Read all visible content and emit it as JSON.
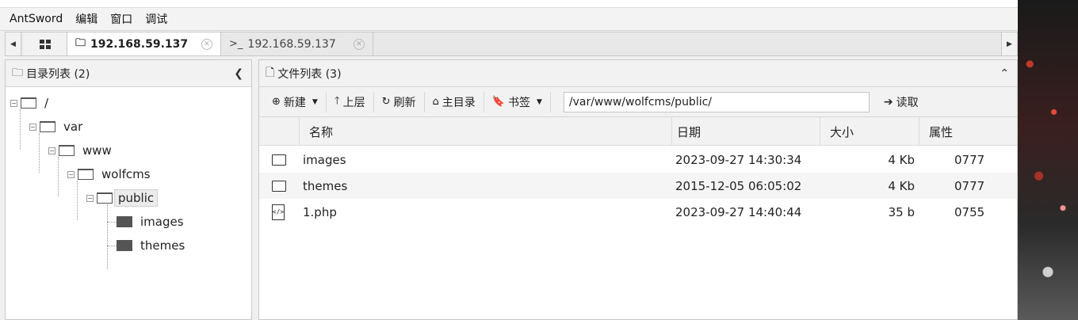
{
  "app_menu": [
    "AntSword",
    "编辑",
    "窗口",
    "调试"
  ],
  "tabs": [
    {
      "label": "192.168.59.137",
      "icon": "folder-outline-icon",
      "active": true
    },
    {
      "label": "192.168.59.137",
      "icon": "terminal-icon",
      "active": false
    }
  ],
  "dir_panel": {
    "title": "目录列表 (2)",
    "tree": [
      {
        "label": "/"
      },
      {
        "label": "var"
      },
      {
        "label": "www"
      },
      {
        "label": "wolfcms"
      },
      {
        "label": "public",
        "selected": true
      },
      {
        "label": "images"
      },
      {
        "label": "themes"
      }
    ]
  },
  "file_panel": {
    "title": "文件列表 (3)",
    "toolbar": {
      "new_label": "新建",
      "up_label": "上层",
      "refresh_label": "刷新",
      "home_label": "主目录",
      "bookmark_label": "书签",
      "path_value": "/var/www/wolfcms/public/",
      "read_label": "读取"
    },
    "columns": [
      "名称",
      "日期",
      "大小",
      "属性"
    ],
    "rows": [
      {
        "name": "images",
        "date": "2023-09-27 14:30:34",
        "size": "4 Kb",
        "perm": "0777",
        "type": "folder"
      },
      {
        "name": "themes",
        "date": "2015-12-05 06:05:02",
        "size": "4 Kb",
        "perm": "0777",
        "type": "folder"
      },
      {
        "name": "1.php",
        "date": "2023-09-27 14:40:44",
        "size": "35 b",
        "perm": "0755",
        "type": "php"
      }
    ]
  }
}
